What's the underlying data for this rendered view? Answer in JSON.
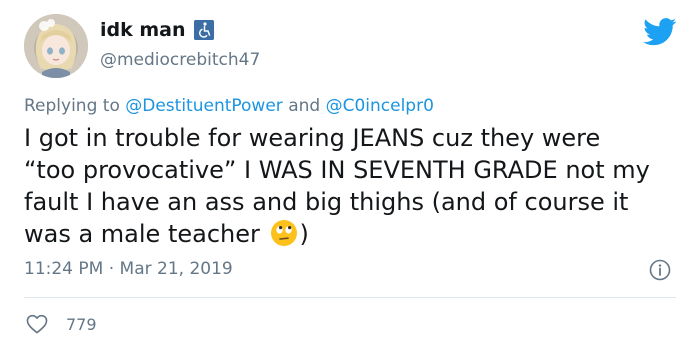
{
  "user": {
    "display_name": "idk man",
    "handle": "@mediocrebitch47",
    "badge_icon": "accessibility-icon",
    "avatar_icon": "anime-avatar"
  },
  "reply": {
    "prefix": "Replying to",
    "mention_1": "@DestituentPower",
    "joiner": "and",
    "mention_2": "@C0incelpr0"
  },
  "tweet": {
    "text_main": "I got in trouble for wearing JEANS cuz they were “too provocative” I WAS IN SEVENTH GRADE not my fault I have an ass and big thighs (and of course it was a male teacher",
    "text_end": ")",
    "emoji": "eye-roll-emoji"
  },
  "meta": {
    "time": "11:24 PM",
    "separator": "·",
    "date": "Mar 21, 2019"
  },
  "engagement": {
    "likes": "779"
  },
  "colors": {
    "twitter_blue": "#1da1f2",
    "mention": "#1b95e0",
    "secondary_text": "#657786",
    "primary_text": "#14171a",
    "badge": "#3b6ea5"
  }
}
